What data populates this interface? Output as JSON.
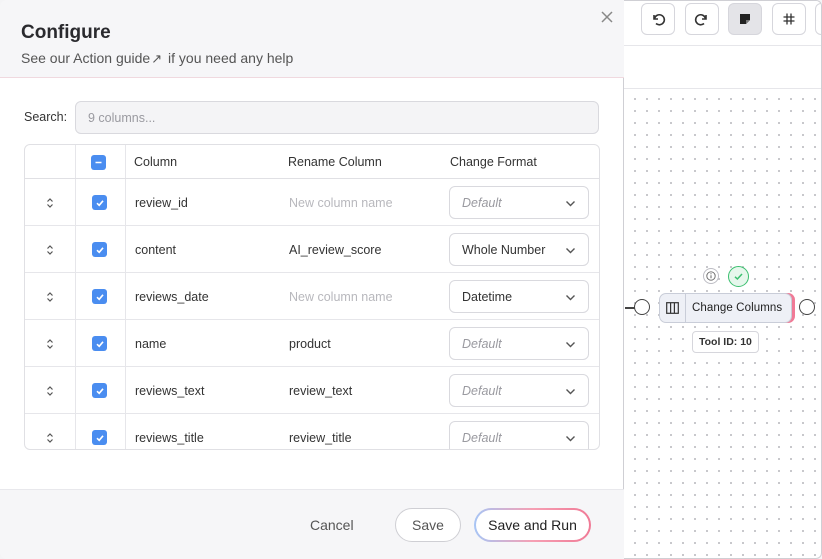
{
  "modal": {
    "title": "Configure",
    "subtitle_prefix": "See our ",
    "subtitle_link": "Action guide",
    "subtitle_link_arrow": "↗",
    "subtitle_suffix": " if you need any help",
    "search_label": "Search:",
    "search_placeholder": "9 columns...",
    "headers": {
      "column": "Column",
      "rename": "Rename Column",
      "format": "Change Format"
    },
    "rows": [
      {
        "column": "review_id",
        "rename": "",
        "rename_placeholder": "New column name",
        "format": "Default",
        "format_is_default": true
      },
      {
        "column": "content",
        "rename": "AI_review_score",
        "rename_placeholder": "",
        "format": "Whole Number",
        "format_is_default": false
      },
      {
        "column": "reviews_date",
        "rename": "",
        "rename_placeholder": "New column name",
        "format": "Datetime",
        "format_is_default": false
      },
      {
        "column": "name",
        "rename": "product",
        "rename_placeholder": "",
        "format": "Default",
        "format_is_default": true
      },
      {
        "column": "reviews_text",
        "rename": "review_text",
        "rename_placeholder": "",
        "format": "Default",
        "format_is_default": true
      },
      {
        "column": "reviews_title",
        "rename": "review_title",
        "rename_placeholder": "",
        "format": "Default",
        "format_is_default": true
      }
    ],
    "footer": {
      "cancel": "Cancel",
      "save": "Save",
      "save_run": "Save and Run"
    }
  },
  "canvas": {
    "node_label": "Change Columns",
    "tool_id": "Tool ID: 10",
    "accent": "#f07a96",
    "success": "#3bbf6f"
  }
}
